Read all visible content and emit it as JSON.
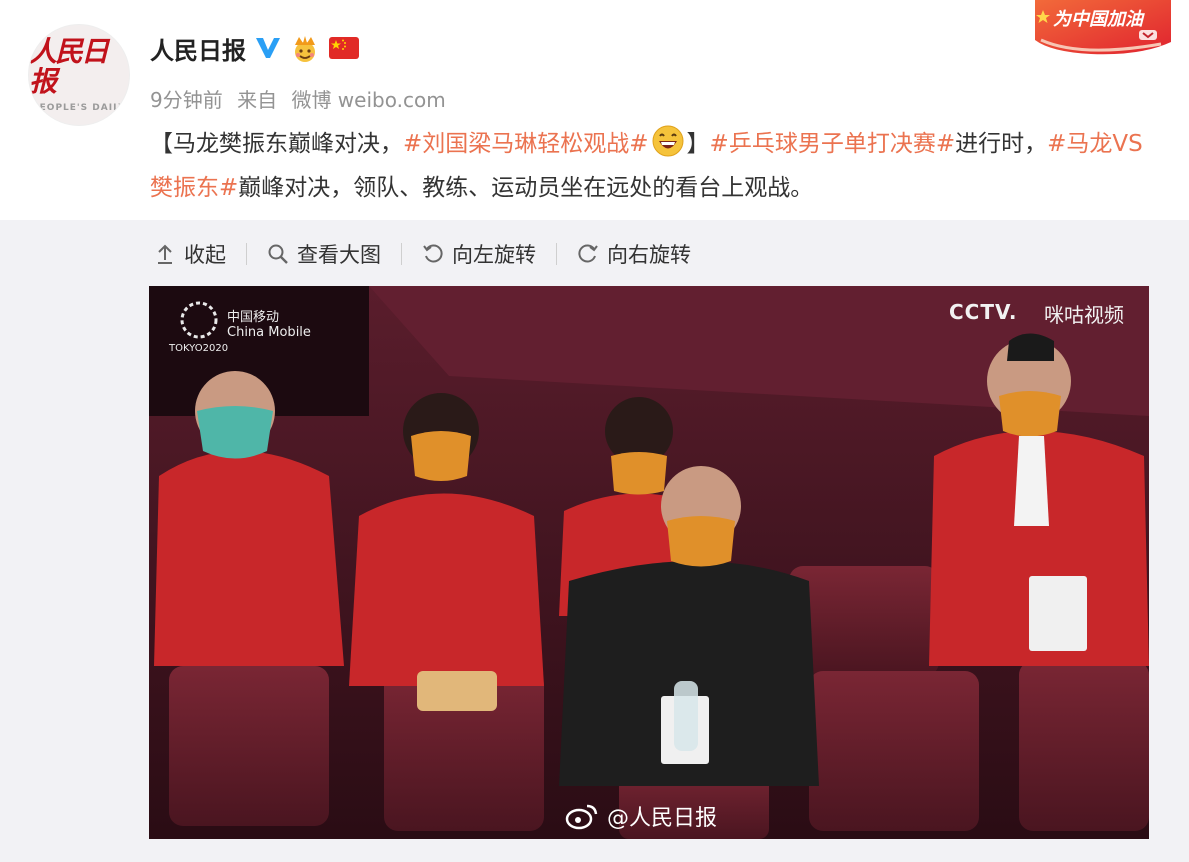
{
  "header": {
    "avatar": {
      "logo_cn": "人民日报",
      "logo_en": "PEOPLE'S DAILY"
    },
    "name": "人民日报",
    "badges": [
      "verified-v-icon",
      "crown-emoji-icon",
      "china-flag-icon"
    ],
    "time": "9分钟前",
    "source_prefix": "来自",
    "source": "微博 weibo.com",
    "corner_banner": "为中国加油"
  },
  "post": {
    "p1": "【马龙樊振东巅峰对决，",
    "topic1": "#刘国梁马琳轻松观战#",
    "p2": "】",
    "topic2": "#乒乓球男子单打决赛#",
    "p3": "进行时，",
    "topic3": "#马龙VS樊振东#",
    "p4": "巅峰对决，领队、教练、运动员坐在远处的看台上观战。"
  },
  "toolbar": {
    "collapse": "收起",
    "view_large": "查看大图",
    "rotate_left": "向左旋转",
    "rotate_right": "向右旋转"
  },
  "photo": {
    "watermark": "@人民日报",
    "broadcaster": "CCTV.",
    "broadcaster_sub": "咪咕视频",
    "olympic_text": "TOKYO2020",
    "sponsor": "中国移动 China Mobile"
  },
  "colors": {
    "topic": "#eb7350",
    "meta": "#939393",
    "media_bg": "#f2f2f5",
    "seat": "#6d2230"
  }
}
